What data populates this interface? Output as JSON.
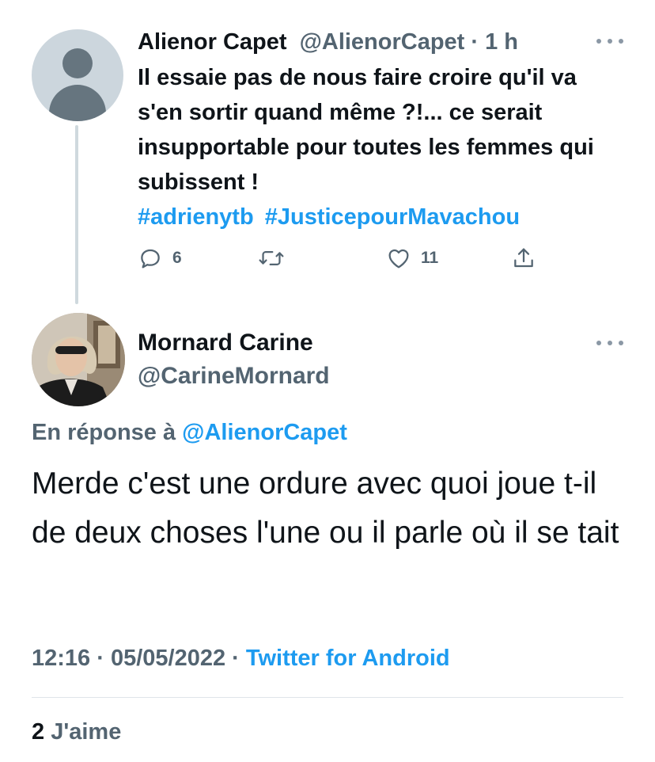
{
  "parent_tweet": {
    "avatar_icon": "default-profile-icon",
    "display_name": "Alienor Capet",
    "handle": "@AlienorCapet",
    "separator": " · ",
    "time": "1 h",
    "text": "Il essaie pas de nous faire croire qu'il va s'en sortir quand même ?!... ce serait insupportable pour toutes les femmes qui subissent !",
    "hashtags": [
      "#adrienytb",
      "#JusticepourMavachou"
    ],
    "actions": {
      "reply": {
        "icon": "reply-icon",
        "count": "6"
      },
      "retweet": {
        "icon": "retweet-icon",
        "count": ""
      },
      "like": {
        "icon": "heart-icon",
        "count": "11"
      },
      "share": {
        "icon": "share-icon"
      }
    },
    "more_icon": "more-options-icon"
  },
  "main_tweet": {
    "display_name": "Mornard Carine",
    "handle": "@CarineMornard",
    "more_icon": "more-options-icon",
    "reply_prefix": "En réponse à ",
    "reply_mention": "@AlienorCapet",
    "text": "Merde c'est une ordure avec quoi joue t-il de deux choses l'une ou il parle où il se tait",
    "time": "12:16",
    "separator1": " · ",
    "date": "05/05/2022",
    "separator2": " · ",
    "source": "Twitter for Android",
    "likes_count": "2",
    "likes_label": "J'aime"
  },
  "colors": {
    "accent": "#1d9bf0",
    "secondary_text": "#536471",
    "primary_text": "#0f1419",
    "divider": "#dfe5e9"
  }
}
